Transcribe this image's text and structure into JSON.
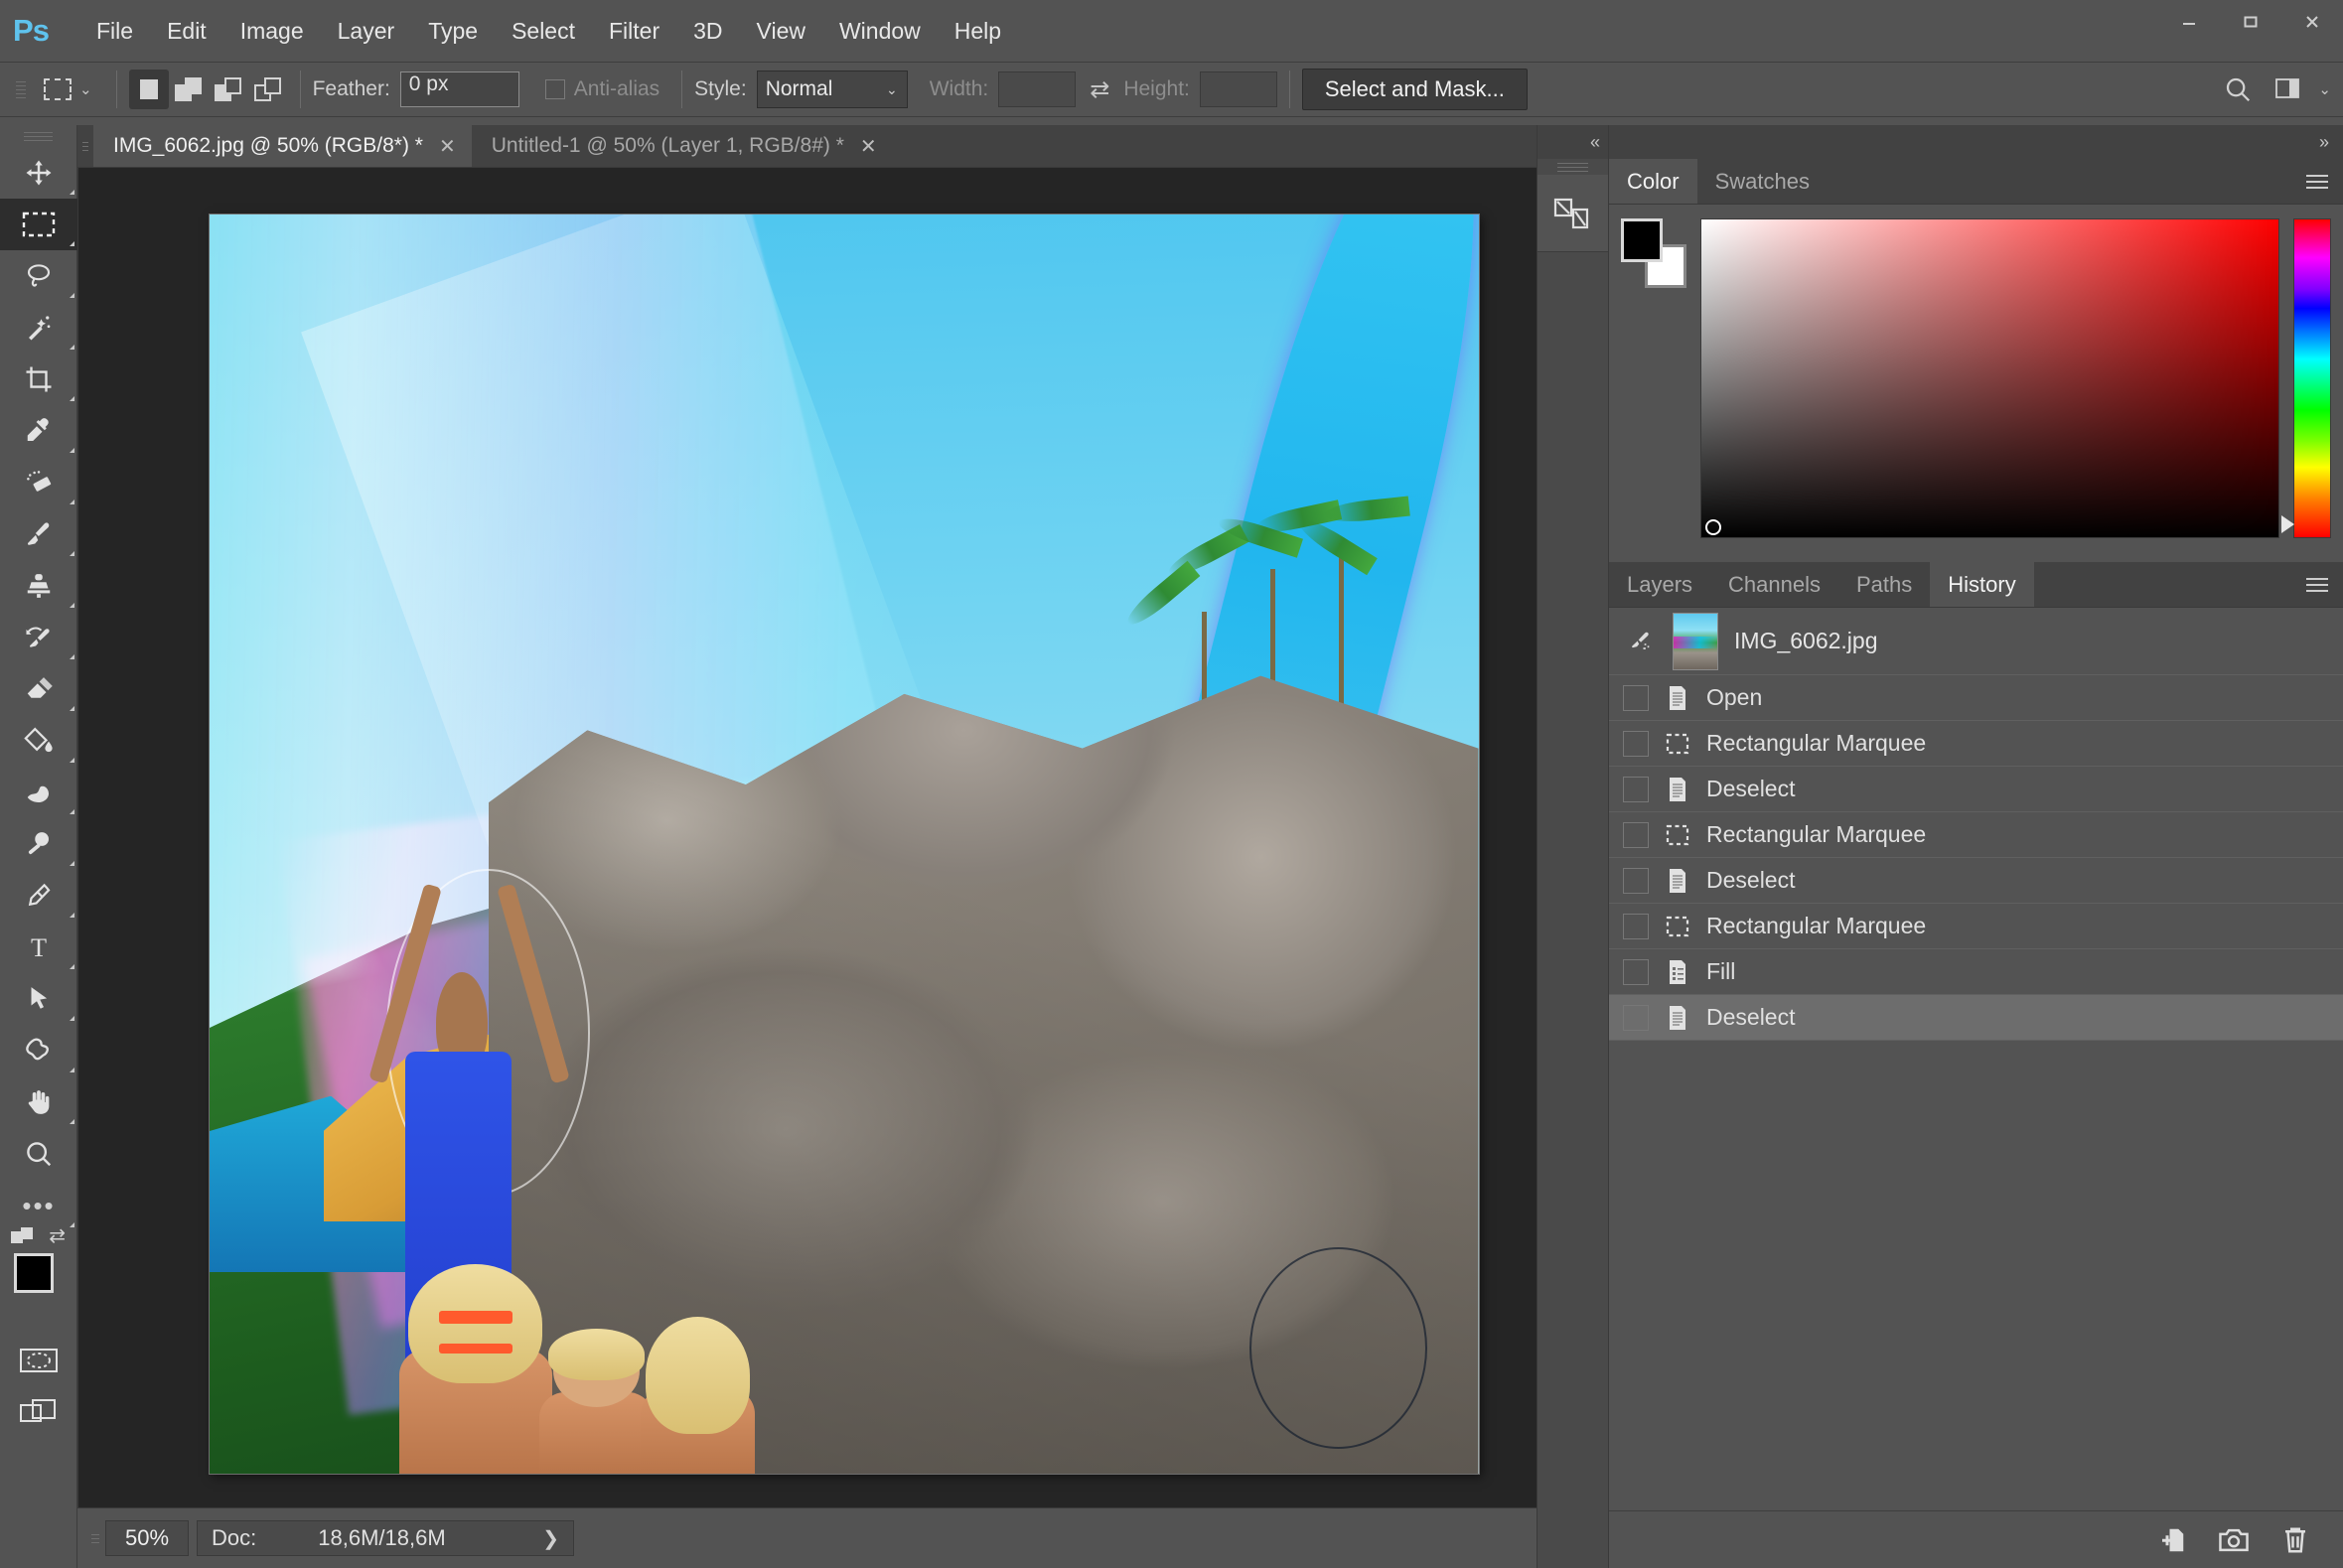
{
  "app": {
    "name": "Adobe Photoshop",
    "logo_text": "Ps"
  },
  "window_controls": {
    "minimize": "—",
    "maximize": "□",
    "close": "✕"
  },
  "menubar": {
    "items": [
      {
        "label": "File"
      },
      {
        "label": "Edit"
      },
      {
        "label": "Image"
      },
      {
        "label": "Layer"
      },
      {
        "label": "Type"
      },
      {
        "label": "Select"
      },
      {
        "label": "Filter"
      },
      {
        "label": "3D"
      },
      {
        "label": "View"
      },
      {
        "label": "Window"
      },
      {
        "label": "Help"
      }
    ]
  },
  "options_bar": {
    "tool_preset_icon": "rectangular-marquee-icon",
    "selection_modes": [
      {
        "name": "new-selection",
        "active": true
      },
      {
        "name": "add-to-selection",
        "active": false
      },
      {
        "name": "subtract-from-selection",
        "active": false
      },
      {
        "name": "intersect-with-selection",
        "active": false
      }
    ],
    "feather_label": "Feather:",
    "feather_value": "0 px",
    "antialias_label": "Anti-alias",
    "antialias_checked": false,
    "style_label": "Style:",
    "style_value": "Normal",
    "width_label": "Width:",
    "width_value": "",
    "swap_icon": "swap-dimensions-icon",
    "height_label": "Height:",
    "height_value": "",
    "select_and_mask": "Select and Mask...",
    "search_icon": "search-icon",
    "workspace_icon": "workspace-switcher-icon"
  },
  "toolbar": {
    "tools": [
      {
        "name": "move-tool",
        "label": "Move",
        "active": false
      },
      {
        "name": "rectangular-marquee-tool",
        "label": "Rectangular Marquee",
        "active": true
      },
      {
        "name": "lasso-tool",
        "label": "Lasso",
        "active": false
      },
      {
        "name": "magic-wand-tool",
        "label": "Quick Selection / Magic Wand",
        "active": false
      },
      {
        "name": "crop-tool",
        "label": "Crop",
        "active": false
      },
      {
        "name": "eyedropper-tool",
        "label": "Eyedropper",
        "active": false
      },
      {
        "name": "spot-healing-brush-tool",
        "label": "Spot Healing Brush",
        "active": false
      },
      {
        "name": "brush-tool",
        "label": "Brush",
        "active": false
      },
      {
        "name": "clone-stamp-tool",
        "label": "Clone Stamp",
        "active": false
      },
      {
        "name": "history-brush-tool",
        "label": "History Brush",
        "active": false
      },
      {
        "name": "eraser-tool",
        "label": "Eraser",
        "active": false
      },
      {
        "name": "gradient-tool",
        "label": "Gradient / Paint Bucket",
        "active": false
      },
      {
        "name": "blur-tool",
        "label": "Blur / Sharpen / Smudge",
        "active": false
      },
      {
        "name": "dodge-tool",
        "label": "Dodge / Burn / Sponge",
        "active": false
      },
      {
        "name": "pen-tool",
        "label": "Pen",
        "active": false
      },
      {
        "name": "type-tool",
        "label": "Horizontal Type",
        "active": false
      },
      {
        "name": "path-selection-tool",
        "label": "Path Selection",
        "active": false
      },
      {
        "name": "shape-tool",
        "label": "Custom Shape",
        "active": false
      },
      {
        "name": "hand-tool",
        "label": "Hand",
        "active": false
      },
      {
        "name": "zoom-tool",
        "label": "Zoom",
        "active": false
      },
      {
        "name": "edit-toolbar-tool",
        "label": "Edit Toolbar",
        "active": false
      }
    ],
    "foreground_color": "#000000",
    "background_color": "#ffffff",
    "quick_mask_icon": "quick-mask-icon",
    "screen_mode_icon": "screen-mode-icon"
  },
  "document_tabs": [
    {
      "title": "IMG_6062.jpg @ 50% (RGB/8*) *",
      "active": true,
      "close": "✕"
    },
    {
      "title": "Untitled-1 @ 50% (Layer 1, RGB/8#) *",
      "active": false,
      "close": "✕"
    }
  ],
  "canvas": {
    "description": "Photo of a person in a blue shirt making a giant soap bubble over a rocky coastline with palm trees and children",
    "zoom": "50%"
  },
  "status_bar": {
    "zoom_value": "50%",
    "doc_label": "Doc:",
    "doc_value": "18,6M/18,6M",
    "expand_arrow": "❯"
  },
  "collapsed_dock": {
    "collapse_icon": "«",
    "buttons": [
      {
        "name": "libraries-icon",
        "label": "Libraries"
      }
    ]
  },
  "right_dock": {
    "expand_icon": "»",
    "color_panel": {
      "tabs": [
        {
          "label": "Color",
          "active": true
        },
        {
          "label": "Swatches",
          "active": false
        }
      ],
      "menu_icon": "panel-menu-icon",
      "foreground_color": "#000000",
      "background_color": "#ffffff",
      "picker_hue": "#ff0000"
    },
    "layers_panel": {
      "tabs": [
        {
          "label": "Layers",
          "active": false
        },
        {
          "label": "Channels",
          "active": false
        },
        {
          "label": "Paths",
          "active": false
        },
        {
          "label": "History",
          "active": true
        }
      ],
      "menu_icon": "panel-menu-icon"
    },
    "history": {
      "snapshot": {
        "name": "IMG_6062.jpg",
        "icon": "history-brush-source-icon"
      },
      "states": [
        {
          "label": "Open",
          "icon": "document-icon",
          "selected": false
        },
        {
          "label": "Rectangular Marquee",
          "icon": "marquee-icon",
          "selected": false
        },
        {
          "label": "Deselect",
          "icon": "document-icon",
          "selected": false
        },
        {
          "label": "Rectangular Marquee",
          "icon": "marquee-icon",
          "selected": false
        },
        {
          "label": "Deselect",
          "icon": "document-icon",
          "selected": false
        },
        {
          "label": "Rectangular Marquee",
          "icon": "marquee-icon",
          "selected": false
        },
        {
          "label": "Fill",
          "icon": "fill-icon",
          "selected": false
        },
        {
          "label": "Deselect",
          "icon": "document-icon",
          "selected": true
        }
      ],
      "footer_buttons": [
        {
          "name": "create-document-from-state-button",
          "icon": "new-document-icon"
        },
        {
          "name": "create-snapshot-button",
          "icon": "camera-icon"
        },
        {
          "name": "delete-state-button",
          "icon": "trash-icon"
        }
      ]
    }
  },
  "colors": {
    "chrome": "#535353",
    "chrome_dark": "#424242",
    "canvas_bg": "#252525",
    "accent_blue": "#5fc3ee",
    "text": "#e8e8e8",
    "text_dim": "#a9a9a9",
    "selected_row": "#6d6d6d"
  }
}
